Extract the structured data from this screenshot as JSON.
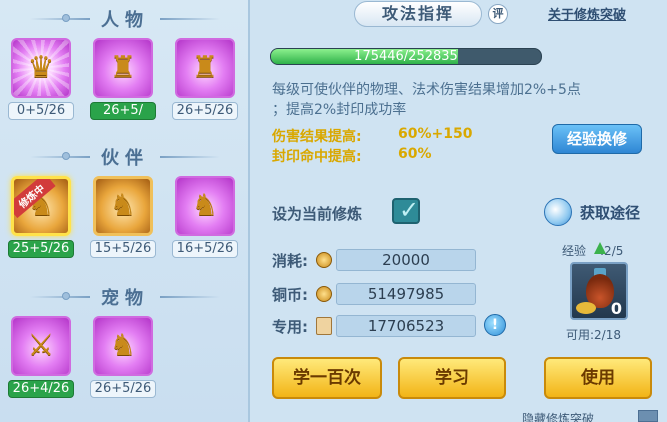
{
  "left": {
    "sections": [
      {
        "title": "人物",
        "slots": [
          {
            "badge": "0+5/26",
            "glyph": "♛",
            "style": "glow",
            "badge_style": ""
          },
          {
            "badge": "26+5/",
            "glyph": "♜",
            "style": "",
            "badge_style": "green"
          },
          {
            "badge": "26+5/26",
            "glyph": "♜",
            "style": "",
            "badge_style": ""
          }
        ]
      },
      {
        "title": "伙伴",
        "slots": [
          {
            "badge": "25+5/26",
            "glyph": "♞",
            "style": "yellow",
            "badge_style": "green",
            "ribbon": "修炼中"
          },
          {
            "badge": "15+5/26",
            "glyph": "♞",
            "style": "yellow",
            "badge_style": ""
          },
          {
            "badge": "16+5/26",
            "glyph": "♞",
            "style": "",
            "badge_style": ""
          }
        ]
      },
      {
        "title": "宠物",
        "slots": [
          {
            "badge": "26+4/26",
            "glyph": "⚔",
            "style": "",
            "badge_style": "green"
          },
          {
            "badge": "26+5/26",
            "glyph": "♞",
            "style": "",
            "badge_style": ""
          }
        ]
      }
    ]
  },
  "right": {
    "tab_title": "攻法指挥",
    "rate_icon": "评",
    "top_link": "关于修炼突破",
    "progress": {
      "text": "175446/252835",
      "value": 175446,
      "max": 252835
    },
    "desc_line1": "每级可使伙伴的物理、法术伤害结果增加2%+5点",
    "desc_line2": "；提高2%封印成功率",
    "stat1_label": "伤害结果提高:",
    "stat1_value": "60%+150",
    "stat2_label": "封印命中提高:",
    "stat2_value": "60%",
    "exchange_button": "经验换修",
    "set_current_label": "设为当前修炼",
    "set_current_checked": true,
    "get_source": "获取途径",
    "cost_label": "消耗:",
    "cost_value": "20000",
    "coins_label": "铜币:",
    "coins_value": "51497985",
    "special_label": "专用:",
    "special_value": "17706523",
    "info_icon": "!",
    "exp_label": "经验",
    "exp_value": ":2/5",
    "item_qty": "0",
    "available": "可用:2/18",
    "btn_learn_100": "学一百次",
    "btn_learn": "学习",
    "btn_use": "使用",
    "bottom_text": "隐藏修炼突破"
  }
}
